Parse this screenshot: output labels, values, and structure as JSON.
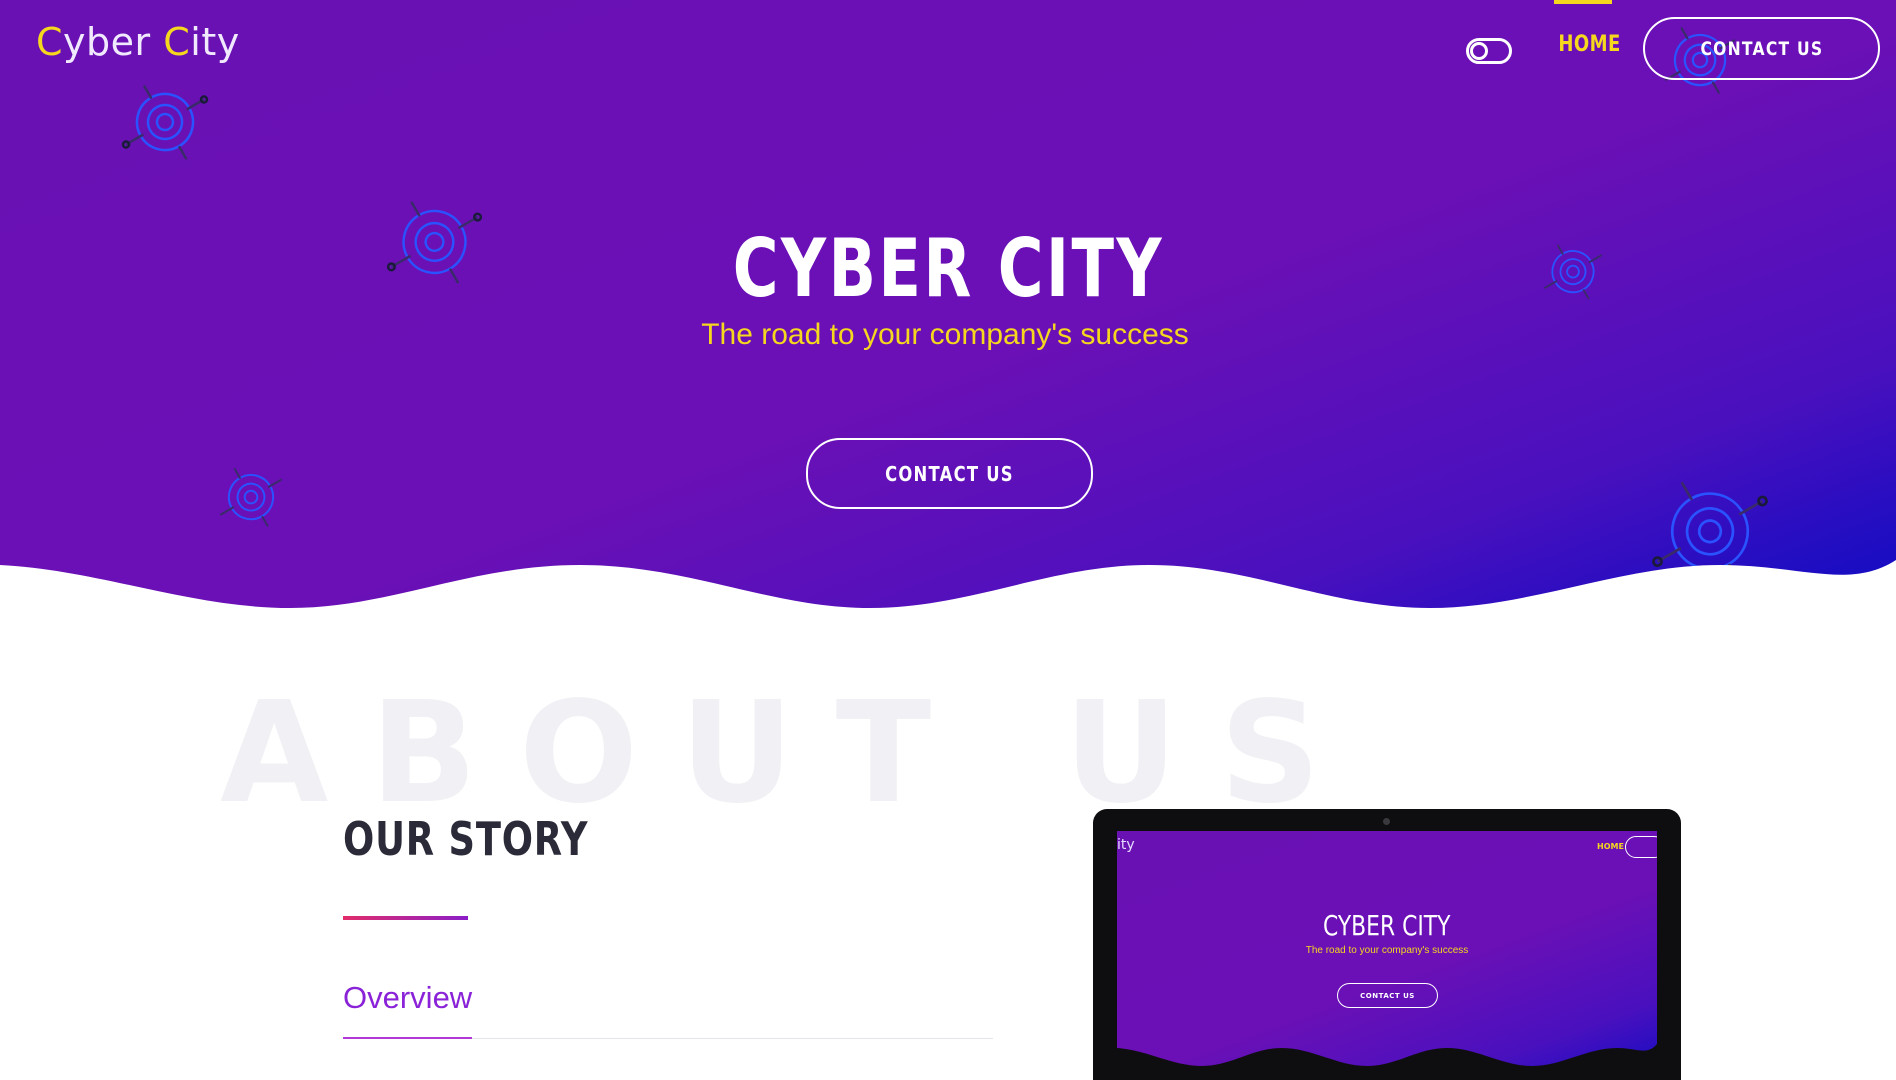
{
  "header": {
    "logo_text_1": "C",
    "logo_text_2": "yber ",
    "logo_text_3": "C",
    "logo_text_4": "ity",
    "nav_home": "HOME",
    "contact_button": "CONTACT US",
    "theme_toggle_icon": "toggle-icon"
  },
  "hero": {
    "title": "CYBER CITY",
    "subtitle": "The road to your company's success",
    "contact_button": "CONTACT US",
    "decoration_icon": "circuit-icon"
  },
  "about": {
    "background_text": "ABOUT US",
    "story_title": "OUR STORY",
    "tabs": [
      {
        "label": "Overview",
        "active": true
      }
    ]
  },
  "mockup": {
    "logo": "ity",
    "nav_home": "HOME",
    "title": "CYBER CITY",
    "subtitle": "The road to your company's success",
    "button": "CONTACT US"
  },
  "colors": {
    "primary_purple": "#6a11b4",
    "accent_yellow": "#f5d71e",
    "deep_blue": "#0b0cc4",
    "tab_purple": "#8a22d8"
  }
}
